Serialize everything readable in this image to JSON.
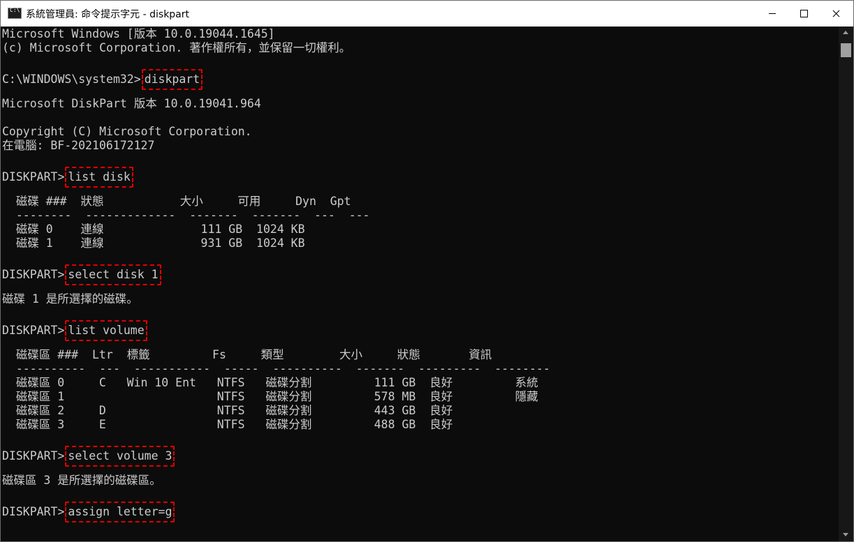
{
  "window": {
    "title": "系統管理員: 命令提示字元 - diskpart",
    "icon": "cmd-icon"
  },
  "titlebar": {
    "minimize": "minimize-icon",
    "maximize": "maximize-icon",
    "close": "close-icon"
  },
  "console": {
    "lines": [
      {
        "text": "Microsoft Windows [版本 10.0.19044.1645]"
      },
      {
        "text": "(c) Microsoft Corporation. 著作權所有，並保留一切權利。"
      },
      {
        "text": ""
      },
      {
        "prompt": "C:\\WINDOWS\\system32>",
        "cmd": "diskpart"
      },
      {
        "text": ""
      },
      {
        "text": "Microsoft DiskPart 版本 10.0.19041.964"
      },
      {
        "text": ""
      },
      {
        "text": "Copyright (C) Microsoft Corporation."
      },
      {
        "text": "在電腦: BF-202106172127"
      },
      {
        "text": ""
      },
      {
        "prompt": "DISKPART>",
        "cmd": "list disk"
      },
      {
        "text": ""
      },
      {
        "text": "  磁碟 ###  狀態           大小     可用     Dyn  Gpt"
      },
      {
        "text": "  --------  -------------  -------  -------  ---  ---"
      },
      {
        "text": "  磁碟 0    連線              111 GB  1024 KB"
      },
      {
        "text": "  磁碟 1    連線              931 GB  1024 KB"
      },
      {
        "text": ""
      },
      {
        "prompt": "DISKPART>",
        "cmd": "select disk 1"
      },
      {
        "text": ""
      },
      {
        "text": "磁碟 1 是所選擇的磁碟。"
      },
      {
        "text": ""
      },
      {
        "prompt": "DISKPART>",
        "cmd": "list volume"
      },
      {
        "text": ""
      },
      {
        "text": "  磁碟區 ###  Ltr  標籤         Fs     類型        大小     狀態       資訊"
      },
      {
        "text": "  ----------  ---  -----------  -----  ----------  -------  ---------  --------"
      },
      {
        "text": "  磁碟區 0     C   Win 10 Ent   NTFS   磁碟分割         111 GB  良好         系統"
      },
      {
        "text": "  磁碟區 1                      NTFS   磁碟分割         578 MB  良好         隱藏"
      },
      {
        "text": "  磁碟區 2     D                NTFS   磁碟分割         443 GB  良好"
      },
      {
        "text": "  磁碟區 3     E                NTFS   磁碟分割         488 GB  良好"
      },
      {
        "text": ""
      },
      {
        "prompt": "DISKPART>",
        "cmd": "select volume 3"
      },
      {
        "text": ""
      },
      {
        "text": "磁碟區 3 是所選擇的磁碟區。"
      },
      {
        "text": ""
      },
      {
        "prompt": "DISKPART>",
        "cmd": "assign letter=g"
      }
    ]
  },
  "colors": {
    "background": "#0c0c0c",
    "text": "#cccccc",
    "highlight": "#e00000"
  }
}
